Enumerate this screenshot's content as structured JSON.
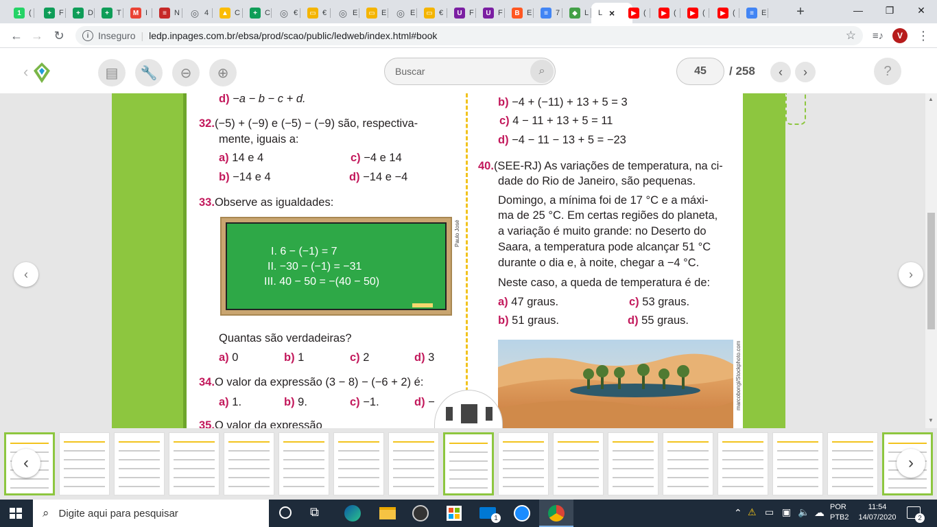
{
  "browser": {
    "tabs": [
      {
        "label": "(",
        "icon": "whatsapp-icon",
        "color": "#25d366",
        "glyph": "1"
      },
      {
        "label": "F",
        "icon": "sheets-icon",
        "color": "#0f9d58",
        "glyph": "+"
      },
      {
        "label": "D",
        "icon": "sheets-icon",
        "color": "#0f9d58",
        "glyph": "+"
      },
      {
        "label": "T",
        "icon": "sheets-icon",
        "color": "#0f9d58",
        "glyph": "+"
      },
      {
        "label": "I",
        "icon": "gmail-icon",
        "color": "#ea4335",
        "glyph": "M"
      },
      {
        "label": "N",
        "icon": "book-icon",
        "color": "#c62828",
        "glyph": "≡"
      },
      {
        "label": "4",
        "icon": "globe-icon",
        "color": "#5f6368",
        "glyph": "◎"
      },
      {
        "label": "C",
        "icon": "drive-icon",
        "color": "#fbbc04",
        "glyph": "▲"
      },
      {
        "label": "C",
        "icon": "sheets-icon",
        "color": "#0f9d58",
        "glyph": "+"
      },
      {
        "label": "€",
        "icon": "globe-icon",
        "color": "#5f6368",
        "glyph": "◎"
      },
      {
        "label": "€",
        "icon": "slides-icon",
        "color": "#f4b400",
        "glyph": "▭"
      },
      {
        "label": "E",
        "icon": "globe-icon",
        "color": "#5f6368",
        "glyph": "◎"
      },
      {
        "label": "E",
        "icon": "slides-icon",
        "color": "#f4b400",
        "glyph": "▭"
      },
      {
        "label": "E",
        "icon": "globe-icon",
        "color": "#5f6368",
        "glyph": "◎"
      },
      {
        "label": "€",
        "icon": "slides-icon",
        "color": "#f4b400",
        "glyph": "▭"
      },
      {
        "label": "F",
        "icon": "forms-icon",
        "color": "#7b1fa2",
        "glyph": "U"
      },
      {
        "label": "F",
        "icon": "forms-icon",
        "color": "#7b1fa2",
        "glyph": "U"
      },
      {
        "label": "E",
        "icon": "blogger-icon",
        "color": "#ff5722",
        "glyph": "B"
      },
      {
        "label": "7",
        "icon": "docs-icon",
        "color": "#4285f4",
        "glyph": "≡"
      },
      {
        "label": "L",
        "icon": "ledp-icon",
        "color": "#43a047",
        "glyph": "◆"
      },
      {
        "label": "L",
        "icon": "close-icon",
        "color": "#ffffff",
        "glyph": "×"
      },
      {
        "label": "(",
        "icon": "youtube-icon",
        "color": "#ff0000",
        "glyph": "▶"
      },
      {
        "label": "(",
        "icon": "youtube-icon",
        "color": "#ff0000",
        "glyph": "▶"
      },
      {
        "label": "(",
        "icon": "youtube-icon",
        "color": "#ff0000",
        "glyph": "▶"
      },
      {
        "label": "(",
        "icon": "youtube-icon",
        "color": "#ff0000",
        "glyph": "▶"
      },
      {
        "label": "E",
        "icon": "docs-icon",
        "color": "#4285f4",
        "glyph": "≡"
      }
    ],
    "new_tab": "+",
    "window_controls": {
      "minimize": "—",
      "restore": "❐",
      "close": "✕"
    },
    "security_label": "Inseguro",
    "url": "ledp.inpages.com.br/ebsa/prod/scao/public/ledweb/index.html#book",
    "avatar_letter": "V"
  },
  "toolbar": {
    "search_placeholder": "Buscar",
    "current_page": "45",
    "total_pages": "/ 258",
    "help": "?"
  },
  "page": {
    "q31d": {
      "opt": "d)",
      "text": "−a − b − c + d."
    },
    "q32": {
      "num": "32.",
      "line1": "(−5) + (−9) e (−5) − (−9) são, respectiva-",
      "line2": "mente, iguais a:",
      "options": [
        {
          "opt": "a)",
          "text": "14 e 4"
        },
        {
          "opt": "c)",
          "text": "−4 e 14"
        },
        {
          "opt": "b)",
          "text": "−14 e 4"
        },
        {
          "opt": "d)",
          "text": "−14 e −4"
        }
      ]
    },
    "q33": {
      "num": "33.",
      "text": "Observe as igualdades:",
      "credit": "Paulo José",
      "equations": [
        "I. 6 − (−1) = 7",
        "II. −30 − (−1) = −31",
        "III. 40 − 50 = −(40 − 50)"
      ],
      "question": "Quantas são verdadeiras?",
      "options": [
        {
          "opt": "a)",
          "text": "0"
        },
        {
          "opt": "b)",
          "text": "1"
        },
        {
          "opt": "c)",
          "text": "2"
        },
        {
          "opt": "d)",
          "text": "3"
        }
      ]
    },
    "q34": {
      "num": "34.",
      "text": "O valor da expressão (3 − 8) − (−6 + 2) é:",
      "options": [
        {
          "opt": "a)",
          "text": "1."
        },
        {
          "opt": "b)",
          "text": "9."
        },
        {
          "opt": "c)",
          "text": "−1."
        },
        {
          "opt": "d)",
          "text": "−"
        }
      ]
    },
    "q35": {
      "num": "35.",
      "text": "O valor da expressão"
    },
    "q39_options": [
      {
        "opt": "b)",
        "text": "−4 + (−11) + 13 + 5 = 3"
      },
      {
        "opt": "c)",
        "text": "4 − 11 + 13 + 5 = 11"
      },
      {
        "opt": "d)",
        "text": "−4 − 11 − 13 + 5 = −23"
      }
    ],
    "q40": {
      "num": "40.",
      "lines1": [
        "(SEE-RJ) As variações de temperatura, na ci-",
        "dade do Rio de Janeiro, são pequenas."
      ],
      "lines2": [
        "Domingo, a mínima foi de 17 °C e a máxi-",
        "ma de 25 °C. Em certas regiões do planeta,",
        "a variação é muito grande: no Deserto do",
        "Saara, a temperatura pode alcançar 51 °C",
        "durante o dia e, à noite, chegar a −4 °C."
      ],
      "question": "Neste caso, a queda de temperatura é de:",
      "options": [
        {
          "opt": "a)",
          "text": "47 graus."
        },
        {
          "opt": "c)",
          "text": "53 graus."
        },
        {
          "opt": "b)",
          "text": "51 graus."
        },
        {
          "opt": "d)",
          "text": "55 graus."
        }
      ],
      "photo_credit": "marcobongi/Stockphoto.com"
    }
  },
  "taskbar": {
    "search_placeholder": "Digite aqui para pesquisar",
    "lang1": "POR",
    "lang2": "PTB2",
    "time": "11:54",
    "date": "14/07/2020",
    "notifications": "2",
    "mail_badge": "1"
  },
  "colors": {
    "accent_pink": "#c2185b",
    "book_green": "#8dc63f",
    "chalkboard_green": "#2ea847"
  }
}
